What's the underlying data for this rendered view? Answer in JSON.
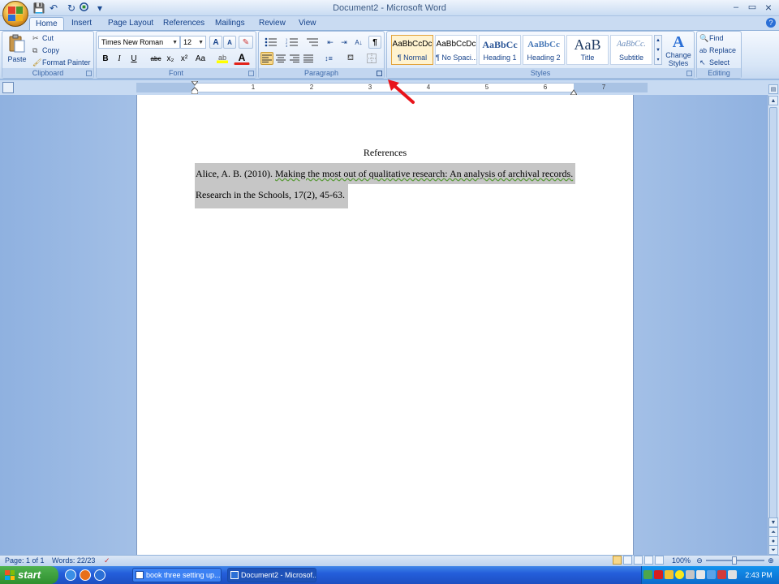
{
  "window": {
    "title": "Document2 - Microsoft Word",
    "controls": {
      "minimize": "–",
      "maximize": "▭",
      "close": "×"
    }
  },
  "qat": {
    "save": "💾",
    "undo": "↶",
    "redo": "↻",
    "custom": "▾"
  },
  "tabs": [
    {
      "label": "Home"
    },
    {
      "label": "Insert"
    },
    {
      "label": "Page Layout"
    },
    {
      "label": "References"
    },
    {
      "label": "Mailings"
    },
    {
      "label": "Review"
    },
    {
      "label": "View"
    }
  ],
  "ribbon": {
    "clipboard": {
      "label": "Clipboard",
      "paste": "Paste",
      "cut": "Cut",
      "copy": "Copy",
      "format_painter": "Format Painter"
    },
    "font": {
      "label": "Font",
      "font_name": "Times New Roman",
      "font_size": "12",
      "bold": "B",
      "italic": "I",
      "underline": "U",
      "strikethrough": "abc",
      "subscript": "x₂",
      "superscript": "x²",
      "change_case": "Aa",
      "font_color": "A",
      "grow": "A",
      "shrink": "A"
    },
    "paragraph": {
      "label": "Paragraph",
      "show_marks": "¶"
    },
    "styles": {
      "label": "Styles",
      "items": [
        {
          "sample": "AaBbCcDc",
          "name": "¶ Normal"
        },
        {
          "sample": "AaBbCcDc",
          "name": "¶ No Spaci..."
        },
        {
          "sample": "AaBbCc",
          "name": "Heading 1"
        },
        {
          "sample": "AaBbCc",
          "name": "Heading 2"
        },
        {
          "sample": "AaB",
          "name": "Title"
        },
        {
          "sample": "AaBbCc.",
          "name": "Subtitle"
        }
      ],
      "change_styles": "Change Styles"
    },
    "editing": {
      "label": "Editing",
      "find": "Find",
      "replace": "Replace",
      "select": "Select"
    }
  },
  "ruler": {
    "numbers": [
      "1",
      "2",
      "3",
      "4",
      "5",
      "6",
      "7"
    ]
  },
  "document": {
    "heading": "References",
    "ref_line1_author": "Alice, A. B. (2010).",
    "ref_line1_title": "Making the most out of qualitative research:  An analysis of archival records.",
    "ref_line2": "Research in the Schools, 17(2), 45-63."
  },
  "status": {
    "page": "Page: 1 of 1",
    "words": "Words: 22/23",
    "zoom": "100%"
  },
  "taskbar": {
    "start": "start",
    "tasks": [
      {
        "label": "book three setting up..."
      },
      {
        "label": "Document2 - Microsof..."
      }
    ],
    "clock": "2:43 PM"
  },
  "colors": {
    "annotation_arrow": "#e8141b",
    "selection": "#c6c6c6"
  }
}
